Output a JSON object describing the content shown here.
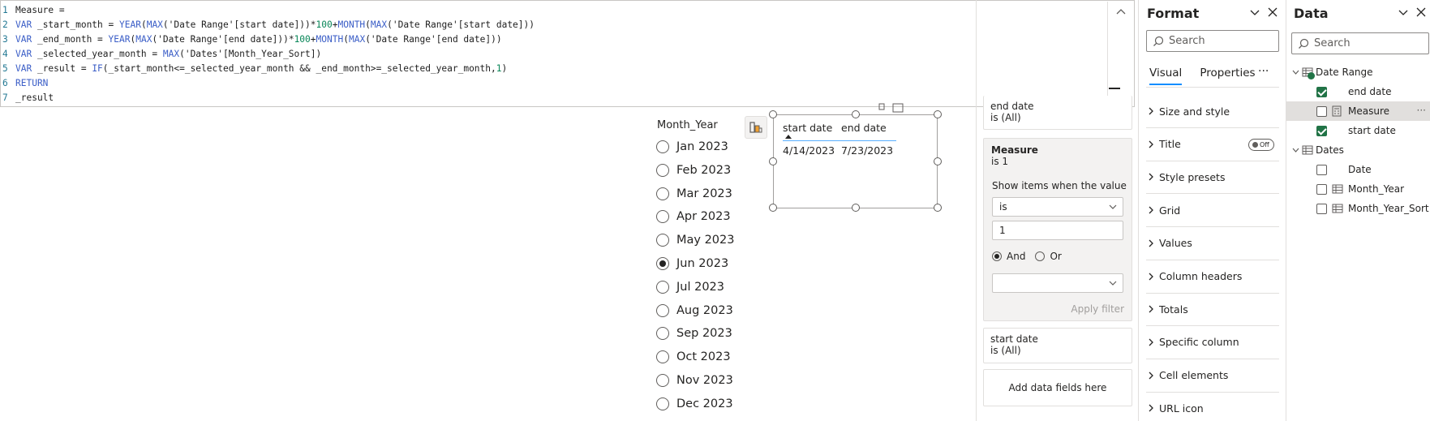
{
  "editor": {
    "lines": [
      {
        "n": "1",
        "parts": [
          {
            "t": "txt",
            "v": "Measure ="
          }
        ]
      },
      {
        "n": "2",
        "parts": [
          {
            "t": "kw",
            "v": "VAR"
          },
          {
            "t": "txt",
            "v": " _start_month = "
          },
          {
            "t": "kw",
            "v": "YEAR"
          },
          {
            "t": "txt",
            "v": "("
          },
          {
            "t": "kw",
            "v": "MAX"
          },
          {
            "t": "txt",
            "v": "('Date Range'[start date]))*"
          },
          {
            "t": "num",
            "v": "100"
          },
          {
            "t": "txt",
            "v": "+"
          },
          {
            "t": "kw",
            "v": "MONTH"
          },
          {
            "t": "txt",
            "v": "("
          },
          {
            "t": "kw",
            "v": "MAX"
          },
          {
            "t": "txt",
            "v": "('Date Range'[start date]))"
          }
        ]
      },
      {
        "n": "3",
        "parts": [
          {
            "t": "kw",
            "v": "VAR"
          },
          {
            "t": "txt",
            "v": " _end_month = "
          },
          {
            "t": "kw",
            "v": "YEAR"
          },
          {
            "t": "txt",
            "v": "("
          },
          {
            "t": "kw",
            "v": "MAX"
          },
          {
            "t": "txt",
            "v": "('Date Range'[end date]))*"
          },
          {
            "t": "num",
            "v": "100"
          },
          {
            "t": "txt",
            "v": "+"
          },
          {
            "t": "kw",
            "v": "MONTH"
          },
          {
            "t": "txt",
            "v": "("
          },
          {
            "t": "kw",
            "v": "MAX"
          },
          {
            "t": "txt",
            "v": "('Date Range'[end date]))"
          }
        ]
      },
      {
        "n": "4",
        "parts": [
          {
            "t": "kw",
            "v": "VAR"
          },
          {
            "t": "txt",
            "v": " _selected_year_month = "
          },
          {
            "t": "kw",
            "v": "MAX"
          },
          {
            "t": "txt",
            "v": "('Dates'[Month_Year_Sort])"
          }
        ]
      },
      {
        "n": "5",
        "parts": [
          {
            "t": "kw",
            "v": "VAR"
          },
          {
            "t": "txt",
            "v": " _result = "
          },
          {
            "t": "kw",
            "v": "IF"
          },
          {
            "t": "txt",
            "v": "(_start_month<=_selected_year_month && _end_month>=_selected_year_month,"
          },
          {
            "t": "num",
            "v": "1"
          },
          {
            "t": "txt",
            "v": ")"
          }
        ]
      },
      {
        "n": "6",
        "parts": [
          {
            "t": "kw",
            "v": "RETURN"
          }
        ]
      },
      {
        "n": "7",
        "parts": [
          {
            "t": "txt",
            "v": "_result"
          }
        ]
      }
    ]
  },
  "slicer": {
    "title": "Month_Year",
    "items": [
      "Jan 2023",
      "Feb 2023",
      "Mar 2023",
      "Apr 2023",
      "May 2023",
      "Jun 2023",
      "Jul 2023",
      "Aug 2023",
      "Sep 2023",
      "Oct 2023",
      "Nov 2023",
      "Dec 2023"
    ],
    "selected": "Jun 2023"
  },
  "table": {
    "headers": [
      "start date",
      "end date"
    ],
    "row": [
      "4/14/2023",
      "7/23/2023"
    ]
  },
  "filters": {
    "end_date": {
      "name": "end date",
      "sub": "is (All)"
    },
    "measure": {
      "name": "Measure",
      "sub": "is 1",
      "show_items_label": "Show items when the value",
      "operator": "is",
      "value": "1",
      "and_label": "And",
      "or_label": "Or",
      "apply_label": "Apply filter"
    },
    "start_date": {
      "name": "start date",
      "sub": "is (All)"
    },
    "add_label": "Add data fields here"
  },
  "format": {
    "title": "Format",
    "search_placeholder": "Search",
    "tab_visual": "Visual",
    "tab_properties": "Properties",
    "more": "···",
    "toggle_label": "Off",
    "sections": [
      "Size and style",
      "Title",
      "Style presets",
      "Grid",
      "Values",
      "Column headers",
      "Totals",
      "Specific column",
      "Cell elements",
      "URL icon"
    ]
  },
  "data": {
    "title": "Data",
    "search_placeholder": "Search",
    "tables": [
      {
        "name": "Date Range",
        "fields": [
          {
            "name": "end date",
            "checked": true,
            "icon": "none"
          },
          {
            "name": "Measure",
            "checked": false,
            "icon": "calculator"
          },
          {
            "name": "start date",
            "checked": true,
            "icon": "none"
          }
        ]
      },
      {
        "name": "Dates",
        "fields": [
          {
            "name": "Date",
            "checked": false,
            "icon": "none"
          },
          {
            "name": "Month_Year",
            "checked": false,
            "icon": "table"
          },
          {
            "name": "Month_Year_Sort",
            "checked": false,
            "icon": "table"
          }
        ]
      }
    ],
    "more": "···"
  },
  "colors": {
    "accent": "#118dff",
    "checked": "#217346",
    "keyword": "#3b5ec7",
    "number": "#098658"
  }
}
